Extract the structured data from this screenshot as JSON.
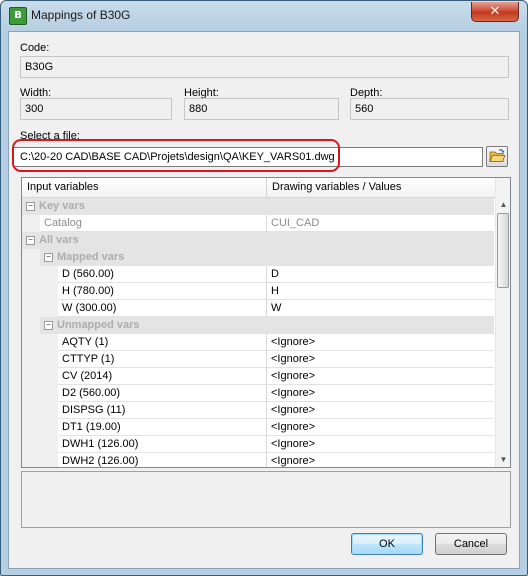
{
  "window": {
    "title": "Mappings of B30G",
    "close_glyph": "✕"
  },
  "code": {
    "label": "Code:",
    "value": "B30G"
  },
  "width": {
    "label": "Width:",
    "value": "300"
  },
  "height": {
    "label": "Height:",
    "value": "880"
  },
  "depth": {
    "label": "Depth:",
    "value": "560"
  },
  "file": {
    "label": "Select a file:",
    "value": "C:\\20-20 CAD\\BASE CAD\\Projets\\design\\QA\\KEY_VARS01.dwg",
    "browse_icon": "folder-open-icon"
  },
  "grid": {
    "columns": [
      "Input variables",
      "Drawing variables / Values"
    ],
    "key_vars": {
      "label": "Key vars",
      "rows": [
        {
          "name": "Catalog",
          "value": "CUI_CAD"
        }
      ]
    },
    "all_vars": {
      "label": "All vars"
    },
    "mapped": {
      "label": "Mapped vars",
      "rows": [
        {
          "name": "D (560.00)",
          "value": "D"
        },
        {
          "name": "H (780.00)",
          "value": "H"
        },
        {
          "name": "W (300.00)",
          "value": "W"
        }
      ]
    },
    "unmapped": {
      "label": "Unmapped vars",
      "rows": [
        {
          "name": "AQTY (1)",
          "value": "<Ignore>"
        },
        {
          "name": "CTTYP (1)",
          "value": "<Ignore>"
        },
        {
          "name": "CV (2014)",
          "value": "<Ignore>"
        },
        {
          "name": "D2 (560.00)",
          "value": "<Ignore>"
        },
        {
          "name": "DISPSG (11)",
          "value": "<Ignore>"
        },
        {
          "name": "DT1 (19.00)",
          "value": "<Ignore>"
        },
        {
          "name": "DWH1 (126.00)",
          "value": "<Ignore>"
        },
        {
          "name": "DWH2 (126.00)",
          "value": "<Ignore>"
        }
      ]
    }
  },
  "buttons": {
    "ok": "OK",
    "cancel": "Cancel"
  },
  "colors": {
    "highlight": "#d8161b",
    "category_bg": "#e4e4e4",
    "category_text": "#adadad"
  }
}
